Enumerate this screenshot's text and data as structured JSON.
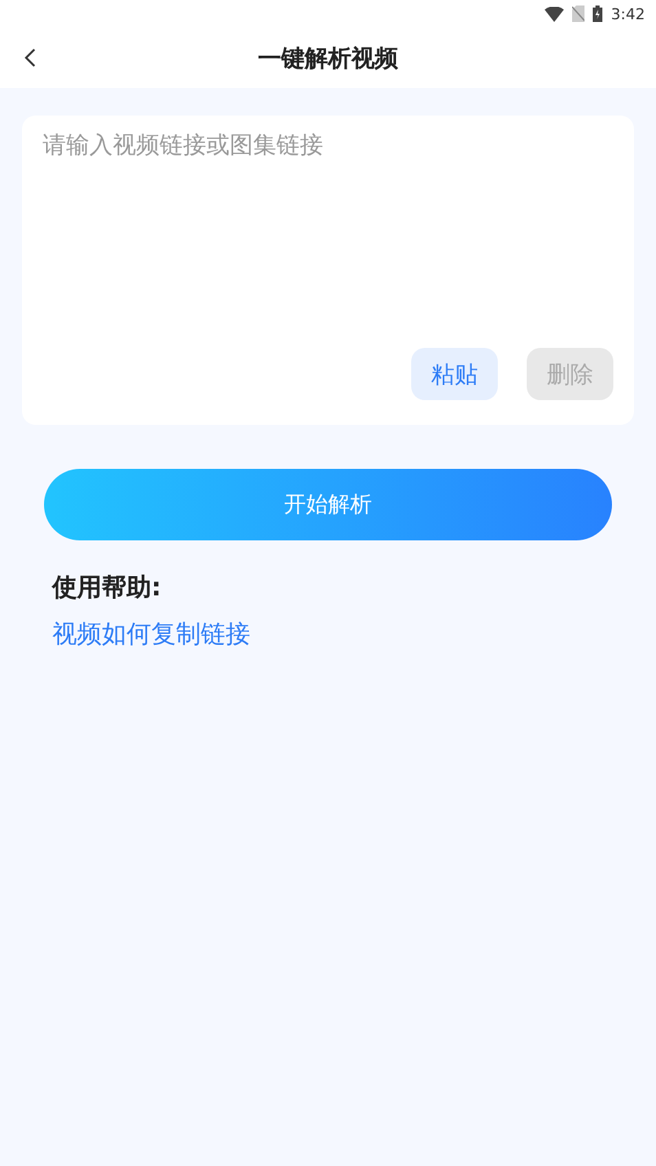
{
  "status_bar": {
    "time": "3:42"
  },
  "header": {
    "title": "一键解析视频"
  },
  "input_card": {
    "placeholder": "请输入视频链接或图集链接",
    "buttons": [
      {
        "label": "粘贴",
        "disabled": false
      },
      {
        "label": "删除",
        "disabled": true
      }
    ]
  },
  "start_button": {
    "label": "开始解析"
  },
  "help": {
    "title": "使用帮助:",
    "links": [
      "视频如何复制链接"
    ]
  }
}
